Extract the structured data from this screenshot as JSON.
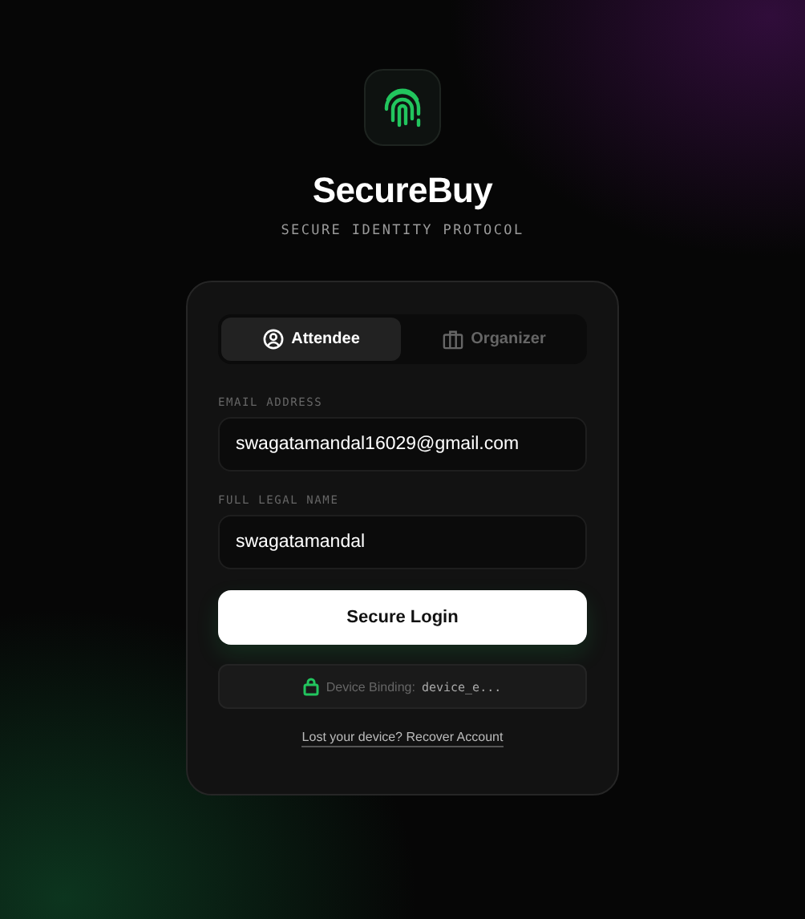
{
  "brand": {
    "title": "SecureBuy",
    "subtitle": "SECURE IDENTITY PROTOCOL"
  },
  "tabs": [
    {
      "label": "Attendee",
      "kind": "person",
      "selected": true
    },
    {
      "label": "Organizer",
      "kind": "briefcase",
      "selected": false
    }
  ],
  "fields": [
    {
      "label": "EMAIL ADDRESS",
      "value": "swagatamandal16029@gmail.com"
    },
    {
      "label": "FULL LEGAL NAME",
      "value": "swagatamandal"
    }
  ],
  "submit": "Secure Login",
  "binding": {
    "label": "Device Binding:",
    "value": "device_e..."
  },
  "recover_link": "Lost your device? Recover Account"
}
